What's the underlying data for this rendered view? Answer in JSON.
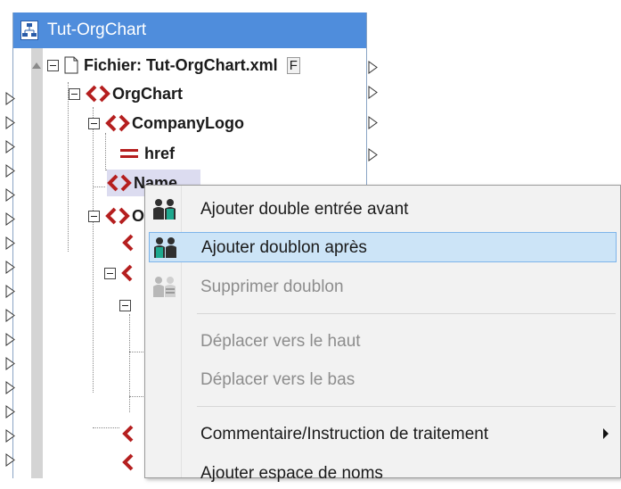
{
  "component": {
    "title": "Tut-OrgChart",
    "tree": {
      "file": {
        "label": "Fichier: Tut-OrgChart.xml",
        "suffix": "F"
      },
      "orgchart": "OrgChart",
      "companylogo": "CompanyLogo",
      "href": "href",
      "name": "Name",
      "partial_o": "O"
    }
  },
  "context_menu": {
    "items": [
      {
        "label": "Ajouter double entrée avant",
        "state": "normal",
        "icon": "people-duplicate-icon"
      },
      {
        "label": "Ajouter doublon après",
        "state": "highlighted",
        "icon": "people-duplicate-icon"
      },
      {
        "label": "Supprimer doublon",
        "state": "disabled",
        "icon": "people-remove-icon"
      },
      {
        "label": "Déplacer vers le haut",
        "state": "disabled"
      },
      {
        "label": "Déplacer vers le bas",
        "state": "disabled"
      },
      {
        "label": "Commentaire/Instruction de traitement",
        "state": "normal",
        "has_submenu": true
      },
      {
        "label": "Ajouter espace de noms",
        "state": "normal"
      }
    ]
  },
  "colors": {
    "title_bar": "#4f8ddc",
    "element_icon": "#b51f1f",
    "menu_highlight": "#cce4f7",
    "menu_highlight_border": "#7eb4ea"
  }
}
